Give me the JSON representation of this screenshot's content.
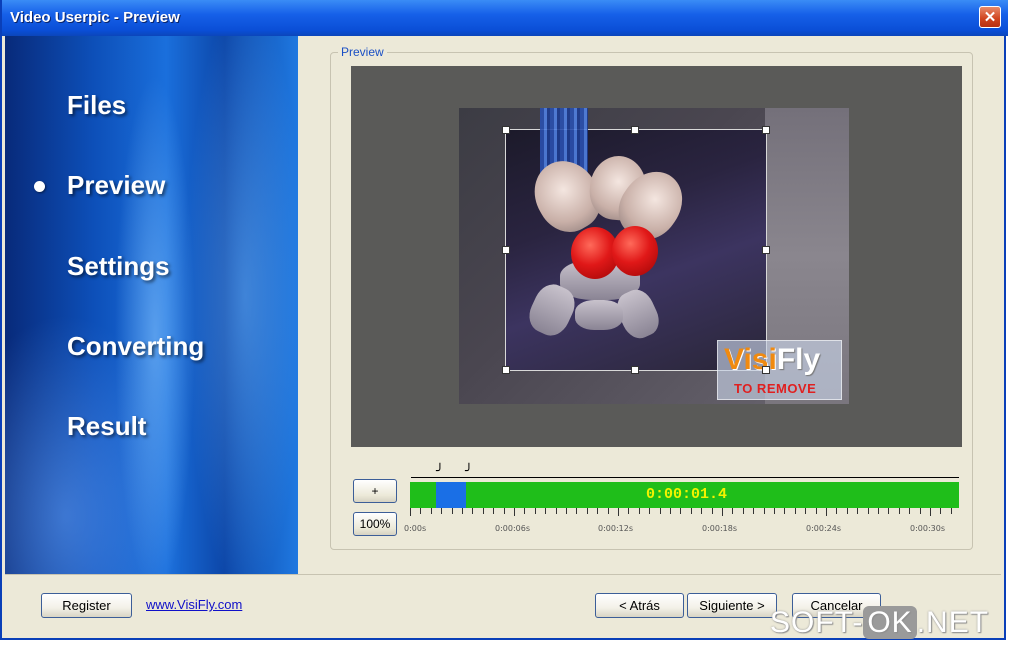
{
  "window": {
    "title": "Video Userpic - Preview",
    "close_glyph": "✕"
  },
  "sidebar": {
    "items": [
      {
        "label": "Files"
      },
      {
        "label": "Preview",
        "active": true
      },
      {
        "label": "Settings"
      },
      {
        "label": "Converting"
      },
      {
        "label": "Result"
      }
    ]
  },
  "preview": {
    "group_label": "Preview",
    "watermark": {
      "logo_a": "Visi",
      "logo_b": "Fly",
      "subtitle": "TO REMOVE"
    }
  },
  "controls": {
    "add_label": "+",
    "zoom_label": "100%"
  },
  "timeline": {
    "current_time": "0:00:01.4",
    "tick_labels": [
      "0:00s",
      "0:00:06s",
      "0:00:12s",
      "0:00:18s",
      "0:00:24s",
      "0:00:30s"
    ]
  },
  "footer": {
    "register_label": "Register",
    "link_text": "www.VisiFly.com",
    "back_label": "< Atrás",
    "next_label": "Siguiente >",
    "cancel_label": "Cancelar"
  },
  "site_watermark": {
    "part1": "SOFT-",
    "part2": "OK",
    "part3": ".NET"
  },
  "colors": {
    "title_bar": "#0a4ed6",
    "timeline_green": "#1fbe1a",
    "selection_blue": "#1a6fe6",
    "time_yellow": "#f3f300"
  }
}
